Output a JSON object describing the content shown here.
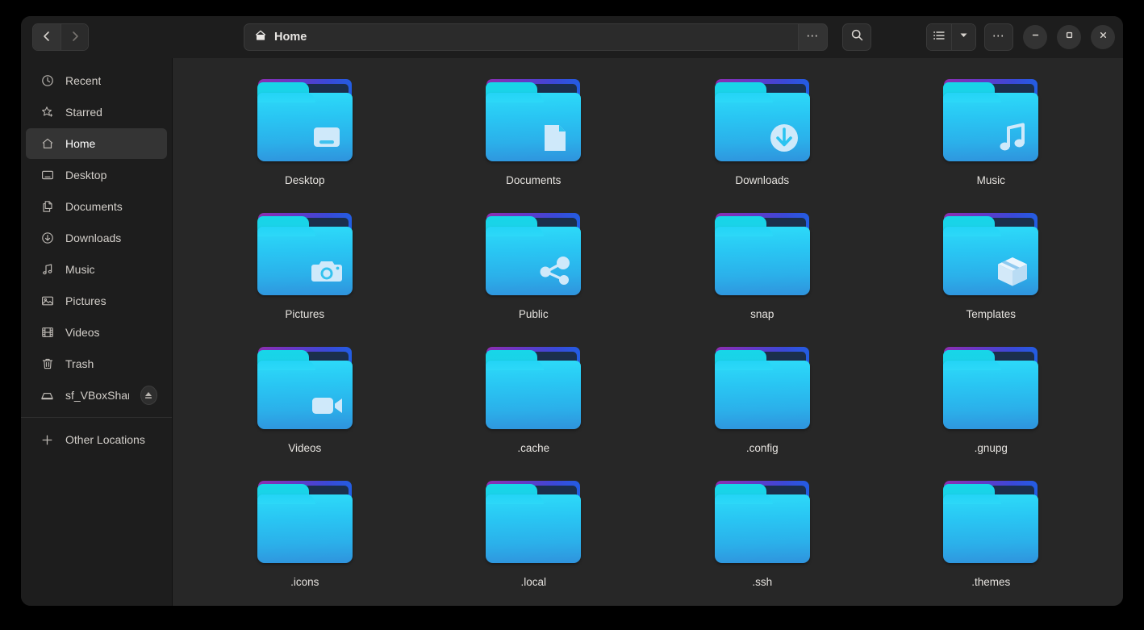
{
  "window": {
    "title": "Home",
    "back_label": "Back",
    "forward_label": "Forward",
    "path_label": "Home",
    "path_menu_label": "⋯",
    "search_label": "Search",
    "view_list_label": "List view",
    "view_dropdown_label": "View options",
    "main_menu_label": "⋯",
    "minimize_label": "Minimize",
    "maximize_label": "Maximize",
    "close_label": "Close"
  },
  "sidebar": {
    "items": [
      {
        "label": "Recent",
        "icon": "clock-icon",
        "active": false
      },
      {
        "label": "Starred",
        "icon": "star-icon",
        "active": false
      },
      {
        "label": "Home",
        "icon": "home-icon",
        "active": true
      },
      {
        "label": "Desktop",
        "icon": "desktop-icon",
        "active": false
      },
      {
        "label": "Documents",
        "icon": "documents-icon",
        "active": false
      },
      {
        "label": "Downloads",
        "icon": "download-icon",
        "active": false
      },
      {
        "label": "Music",
        "icon": "music-icon",
        "active": false
      },
      {
        "label": "Pictures",
        "icon": "image-icon",
        "active": false
      },
      {
        "label": "Videos",
        "icon": "film-icon",
        "active": false
      },
      {
        "label": "Trash",
        "icon": "trash-icon",
        "active": false
      },
      {
        "label": "sf_VBoxShare",
        "icon": "drive-icon",
        "active": false,
        "eject": true
      }
    ],
    "other_locations": {
      "label": "Other Locations",
      "icon": "plus-icon"
    }
  },
  "files": [
    {
      "name": "Desktop",
      "emblem": "monitor-emblem"
    },
    {
      "name": "Documents",
      "emblem": "document-emblem"
    },
    {
      "name": "Downloads",
      "emblem": "download-emblem"
    },
    {
      "name": "Music",
      "emblem": "note-emblem"
    },
    {
      "name": "Pictures",
      "emblem": "camera-emblem"
    },
    {
      "name": "Public",
      "emblem": "share-emblem"
    },
    {
      "name": "snap",
      "emblem": "none"
    },
    {
      "name": "Templates",
      "emblem": "box-emblem"
    },
    {
      "name": "Videos",
      "emblem": "video-emblem"
    },
    {
      "name": ".cache",
      "emblem": "none"
    },
    {
      "name": ".config",
      "emblem": "none"
    },
    {
      "name": ".gnupg",
      "emblem": "none"
    },
    {
      "name": ".icons",
      "emblem": "none"
    },
    {
      "name": ".local",
      "emblem": "none"
    },
    {
      "name": ".ssh",
      "emblem": "none"
    },
    {
      "name": ".themes",
      "emblem": "none"
    }
  ],
  "colors": {
    "window_bg": "#242424",
    "header_bg": "#1d1d1d",
    "sidebar_bg": "#1d1d1d",
    "files_bg": "#272727",
    "selection": "#343434",
    "folder_cyan": "#2ddcf9",
    "folder_blue": "#2f93dd",
    "folder_purple": "#8c2fb0"
  }
}
